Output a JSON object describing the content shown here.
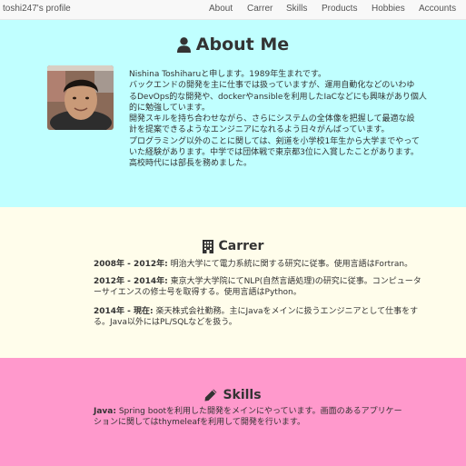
{
  "nav": {
    "brand": "toshi247's profile",
    "items": [
      "About",
      "Carrer",
      "Skills",
      "Products",
      "Hobbies",
      "Accounts"
    ]
  },
  "about": {
    "title": "About Me",
    "icon": "user-icon",
    "lines": [
      "Nishina Toshiharuと申します。1989年生まれです。",
      "バックエンドの開発を主に仕事では扱っていますが、運用自動化などのいわゆ",
      "るDevOps的な開発や、dockerやansibleを利用したIaCなどにも興味があり個人",
      "的に勉強しています。",
      "開発スキルを持ち合わせながら、さらにシステムの全体像を把握して最適な設",
      "計を提案できるようなエンジニアになれるよう日々がんばっています。",
      "プログラミング以外のことに関しては、剣道を小学校1年生から大学までやって",
      "いた経験があります。中学では団体戦で東京都3位に入賞したことがあります。",
      "高校時代には部長を務めました。"
    ]
  },
  "carrer": {
    "title": "Carrer",
    "icon": "building-icon",
    "entries": [
      {
        "period": "2008年 - 2012年:",
        "lines": [
          "明治大学にて電力系統に関する研究に従事。使用言語はFortran。"
        ]
      },
      {
        "period": "2012年 - 2014年:",
        "lines": [
          "東京大学大学院にてNLP(自然言語処理)の研究に従事。コンピュータ",
          "ーサイエンスの修士号を取得する。使用言語はPython。"
        ]
      },
      {
        "period": "2014年 - 現在:",
        "lines": [
          "楽天株式会社勤務。主にJavaをメインに扱うエンジニアとして仕事をす",
          "る。Java以外にはPL/SQLなどを扱う。"
        ]
      }
    ]
  },
  "skills": {
    "title": "Skills",
    "icon": "pencil-icon",
    "entries": [
      {
        "label": "Java:",
        "lines": [
          "Spring bootを利用した開発をメインにやっています。画面のあるアプリケー",
          "ションに関してはthymeleafを利用して開発を行います。"
        ]
      }
    ]
  },
  "colors": {
    "about_bg": "#c0ffff",
    "carrer_bg": "#fffdeb",
    "skills_bg": "#ff99cc",
    "navbar_bg": "#f8f8f8"
  }
}
